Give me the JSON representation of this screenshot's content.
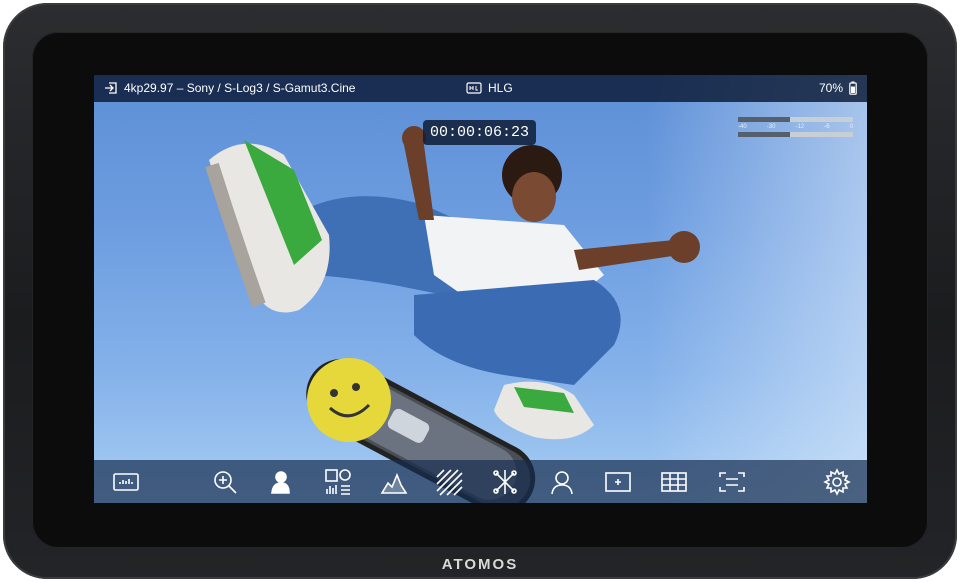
{
  "device": {
    "brand": "ATOMOS"
  },
  "status": {
    "input_format": "4kp29.97 – Sony / S-Log3 / S-Gamut3.Cine",
    "hdr_mode": "HLG",
    "battery": "70%"
  },
  "timecode": "00:00:06:23",
  "audio_meters": {
    "scale": [
      "-40",
      "-30",
      "-12",
      "-6",
      "0"
    ],
    "levels": [
      0.45,
      0.45
    ]
  },
  "toolbar": {
    "items": [
      "waveform-panel-icon",
      "zoom-icon",
      "false-color-icon",
      "scopes-icon",
      "histogram-icon",
      "zebra-icon",
      "focus-peaking-icon",
      "skin-tone-icon",
      "center-marker-icon",
      "grid-icon",
      "frame-guides-icon",
      "settings-icon"
    ]
  },
  "colors": {
    "status_bg": "#0a1834",
    "sky_top": "#5d8fd6",
    "sky_bottom": "#a8cdf3",
    "bezel": "#0c0c0d"
  }
}
